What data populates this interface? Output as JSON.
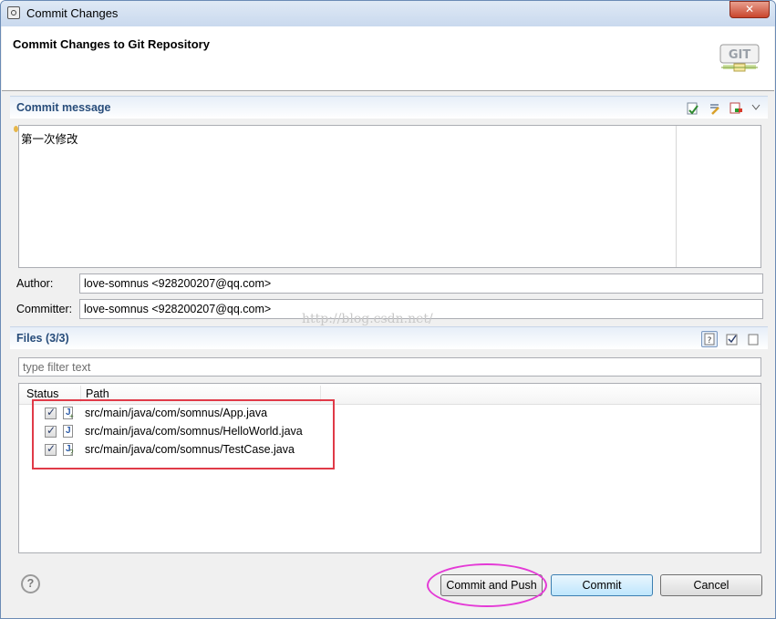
{
  "window": {
    "title": "Commit Changes",
    "close_label": "✕"
  },
  "header": {
    "title": "Commit Changes to Git Repository",
    "logo_text": "GIT"
  },
  "commit_message": {
    "section_title": "Commit message",
    "text": "第一次修改"
  },
  "author": {
    "label": "Author:",
    "value": "love-somnus <928200207@qq.com>"
  },
  "committer": {
    "label": "Committer:",
    "value": "love-somnus <928200207@qq.com>"
  },
  "watermark": "http://blog.csdn.net/",
  "files": {
    "section_title": "Files (3/3)",
    "filter_placeholder": "type filter text",
    "columns": [
      "Status",
      "Path"
    ],
    "rows": [
      {
        "checked": true,
        "icon": "java-file-added-icon",
        "path": "src/main/java/com/somnus/App.java"
      },
      {
        "checked": true,
        "icon": "java-file-icon",
        "path": "src/main/java/com/somnus/HelloWorld.java"
      },
      {
        "checked": true,
        "icon": "java-file-untracked-icon",
        "path": "src/main/java/com/somnus/TestCase.java"
      }
    ]
  },
  "buttons": {
    "help": "?",
    "commit_and_push": "Commit and Push",
    "commit": "Commit",
    "cancel": "Cancel"
  },
  "colors": {
    "accent_title": "#274c7a",
    "highlight_red": "#e03a48",
    "highlight_magenta": "#e43ad6"
  }
}
